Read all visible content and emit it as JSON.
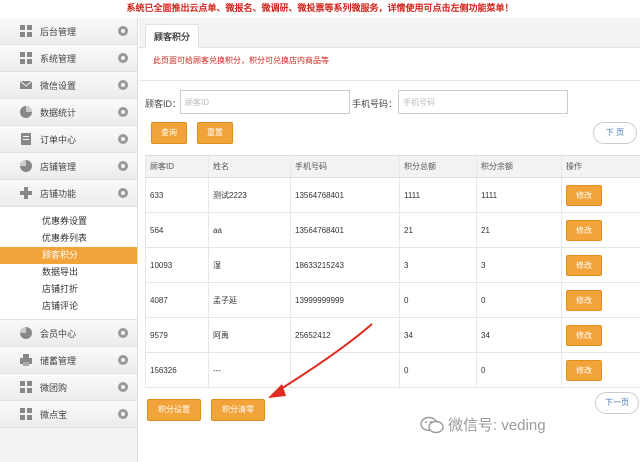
{
  "banner": "系统已全面推出云点单、微报名、微调研、微投票等系列微服务，详情使用可点击左侧功能菜单！",
  "sidebar": {
    "items": [
      {
        "label": "后台管理",
        "icon": "grid-icon"
      },
      {
        "label": "系统管理",
        "icon": "grid-icon"
      },
      {
        "label": "微信设置",
        "icon": "envelope-icon"
      },
      {
        "label": "数据统计",
        "icon": "chart-icon"
      },
      {
        "label": "订单中心",
        "icon": "list-icon"
      },
      {
        "label": "店铺管理",
        "icon": "pie-icon"
      },
      {
        "label": "店铺功能",
        "icon": "plus-icon"
      }
    ],
    "submenu": [
      {
        "label": "优惠券设置"
      },
      {
        "label": "优惠券列表"
      },
      {
        "label": "顾客积分"
      },
      {
        "label": "数据导出"
      },
      {
        "label": "店铺打折"
      },
      {
        "label": "店铺评论"
      }
    ],
    "bottom_items": [
      {
        "label": "会员中心",
        "icon": "pie-icon"
      },
      {
        "label": "储蓄管理",
        "icon": "printer-icon"
      },
      {
        "label": "微团购",
        "icon": "grid-icon"
      },
      {
        "label": "微点宝",
        "icon": "grid-icon"
      }
    ]
  },
  "tab": "顾客积分",
  "notice": "此页面可给顾客兑换积分，积分可兑换店内商品等",
  "search": {
    "customer_id_label": "顾客ID：",
    "customer_id_placeholder": "顾客ID",
    "phone_label": "手机号码：",
    "phone_placeholder": "手机号码",
    "query_btn": "查询",
    "reset_btn": "重置",
    "next_top": "下 页"
  },
  "table": {
    "headers": [
      "顾客ID",
      "姓名",
      "手机号码",
      "积分总额",
      "积分余额",
      "操作"
    ],
    "rows": [
      [
        "633",
        "测试2223",
        "13564768401",
        "1111",
        "1111",
        "修改"
      ],
      [
        "564",
        "aa",
        "13564768401",
        "21",
        "21",
        "修改"
      ],
      [
        "10093",
        "湿",
        "18633215243",
        "3",
        "3",
        "修改"
      ],
      [
        "4087",
        "孟子延",
        "13999999999",
        "0",
        "0",
        "修改"
      ],
      [
        "9579",
        "阿禹",
        "25652412",
        "34",
        "34",
        "修改"
      ],
      [
        "156326",
        "---",
        "",
        "0",
        "0",
        "修改"
      ]
    ]
  },
  "footer": {
    "settings_btn": "积分设置",
    "clear_btn": "积分清零",
    "next_bottom": "下一页"
  },
  "watermark": "微信号: veding",
  "colors": {
    "accent": "#f2a33a",
    "alert": "#d0251c",
    "arrow": "#e02b20"
  }
}
